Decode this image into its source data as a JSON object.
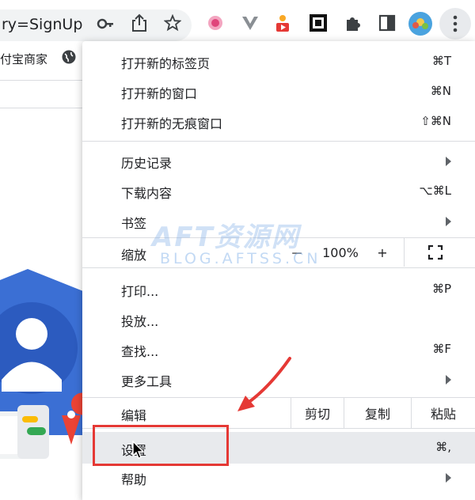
{
  "browser": {
    "url_fragment": "ry=SignUp",
    "bookmark_fragment": "付宝商家"
  },
  "watermark": {
    "main": "AFT资源网",
    "sub": "BLOG.AFTSS.CN"
  },
  "menu": {
    "items_group1": [
      {
        "label": "打开新的标签页",
        "shortcut": "⌘T"
      },
      {
        "label": "打开新的窗口",
        "shortcut": "⌘N"
      },
      {
        "label": "打开新的无痕窗口",
        "shortcut": "⇧⌘N"
      }
    ],
    "items_group2": [
      {
        "label": "历史记录",
        "submenu": true
      },
      {
        "label": "下载内容",
        "shortcut": "⌥⌘L"
      },
      {
        "label": "书签",
        "submenu": true
      }
    ],
    "zoom": {
      "label": "缩放",
      "minus": "－",
      "value": "100%",
      "plus": "+"
    },
    "items_group3": [
      {
        "label": "打印...",
        "shortcut": "⌘P"
      },
      {
        "label": "投放..."
      },
      {
        "label": "查找...",
        "shortcut": "⌘F"
      },
      {
        "label": "更多工具",
        "submenu": true
      }
    ],
    "edit": {
      "label": "编辑",
      "cut": "剪切",
      "copy": "复制",
      "paste": "粘贴"
    },
    "settings": {
      "label": "设置",
      "shortcut": "⌘,"
    },
    "help": {
      "label": "帮助",
      "submenu": true
    }
  },
  "colors": {
    "highlight": "#e8eaed",
    "annotation": "#e53935",
    "avatar_blue": "#3b6fd4"
  }
}
